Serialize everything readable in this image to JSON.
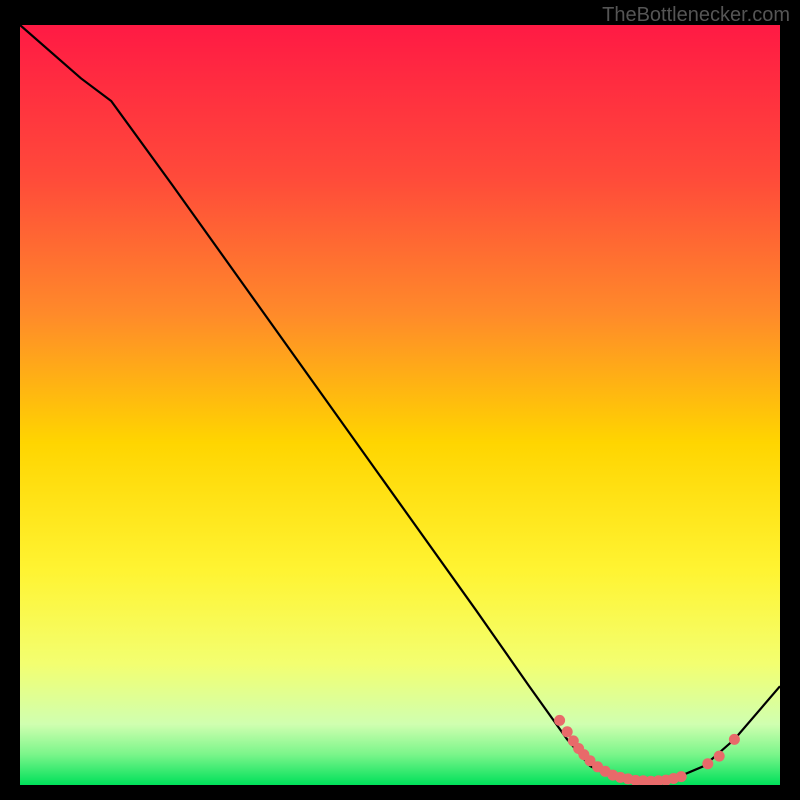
{
  "watermark": "TheBottlenecker.com",
  "colors": {
    "bg": "#000000",
    "gradient_top": "#ff1a44",
    "gradient_mid_upper": "#ff6a2a",
    "gradient_mid": "#ffd500",
    "gradient_mid_lower": "#f9ff3a",
    "gradient_lower": "#e8ff8a",
    "gradient_bottom": "#00e05a",
    "curve": "#000000",
    "dots": "#e86a6a"
  },
  "chart_data": {
    "type": "line",
    "title": "",
    "xlabel": "",
    "ylabel": "",
    "xlim": [
      0,
      100
    ],
    "ylim": [
      0,
      100
    ],
    "curve": [
      {
        "x": 0,
        "y": 100
      },
      {
        "x": 8,
        "y": 93
      },
      {
        "x": 12,
        "y": 90
      },
      {
        "x": 20,
        "y": 79
      },
      {
        "x": 30,
        "y": 65
      },
      {
        "x": 40,
        "y": 51
      },
      {
        "x": 50,
        "y": 37
      },
      {
        "x": 60,
        "y": 23
      },
      {
        "x": 67,
        "y": 13
      },
      {
        "x": 72,
        "y": 6
      },
      {
        "x": 75,
        "y": 2.5
      },
      {
        "x": 78,
        "y": 1
      },
      {
        "x": 82,
        "y": 0.5
      },
      {
        "x": 86,
        "y": 0.8
      },
      {
        "x": 90,
        "y": 2.5
      },
      {
        "x": 94,
        "y": 6
      },
      {
        "x": 100,
        "y": 13
      }
    ],
    "dots": [
      {
        "x": 71,
        "y": 8.5
      },
      {
        "x": 72,
        "y": 7
      },
      {
        "x": 72.8,
        "y": 5.8
      },
      {
        "x": 73.5,
        "y": 4.8
      },
      {
        "x": 74.2,
        "y": 4
      },
      {
        "x": 75,
        "y": 3.2
      },
      {
        "x": 76,
        "y": 2.4
      },
      {
        "x": 77,
        "y": 1.8
      },
      {
        "x": 78,
        "y": 1.3
      },
      {
        "x": 79,
        "y": 1
      },
      {
        "x": 80,
        "y": 0.8
      },
      {
        "x": 81,
        "y": 0.6
      },
      {
        "x": 82,
        "y": 0.55
      },
      {
        "x": 83,
        "y": 0.5
      },
      {
        "x": 84,
        "y": 0.55
      },
      {
        "x": 85,
        "y": 0.65
      },
      {
        "x": 86,
        "y": 0.85
      },
      {
        "x": 87,
        "y": 1.1
      },
      {
        "x": 90.5,
        "y": 2.8
      },
      {
        "x": 92,
        "y": 3.8
      },
      {
        "x": 94,
        "y": 6
      }
    ]
  }
}
